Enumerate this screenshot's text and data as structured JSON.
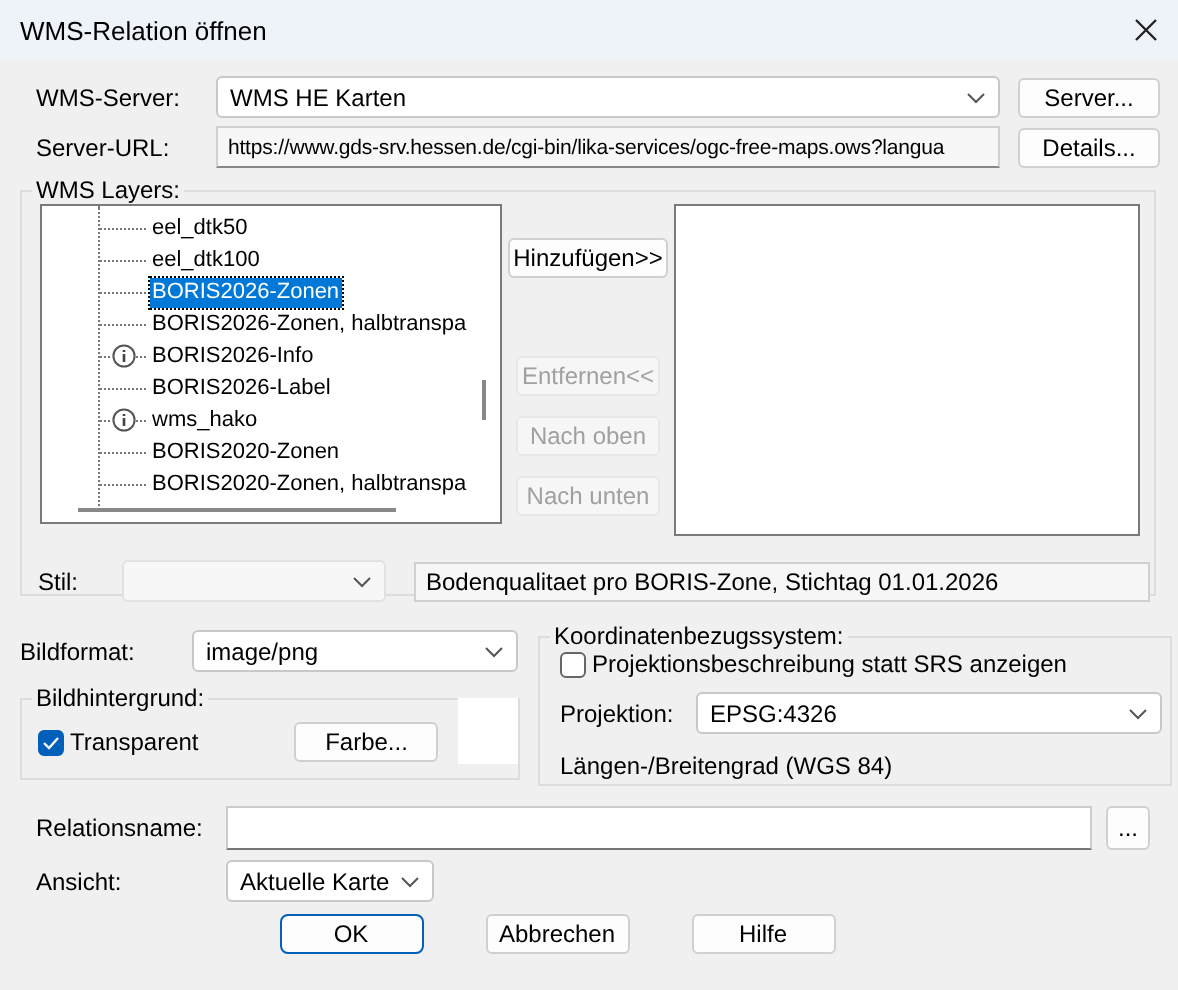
{
  "window": {
    "title": "WMS-Relation öffnen"
  },
  "server": {
    "label": "WMS-Server:",
    "value": "WMS HE Karten",
    "button": "Server..."
  },
  "url": {
    "label": "Server-URL:",
    "value": "https://www.gds-srv.hessen.de/cgi-bin/lika-services/ogc-free-maps.ows?langua",
    "button": "Details..."
  },
  "layers": {
    "title": "WMS Layers:",
    "tree": [
      {
        "label": "eel_dtk50",
        "kind": "layer",
        "selected": false
      },
      {
        "label": "eel_dtk100",
        "kind": "layer",
        "selected": false
      },
      {
        "label": "BORIS2026-Zonen",
        "kind": "layer",
        "selected": true
      },
      {
        "label": "BORIS2026-Zonen, halbtranspa",
        "kind": "layer",
        "selected": false
      },
      {
        "label": "BORIS2026-Info",
        "kind": "info",
        "selected": false
      },
      {
        "label": "BORIS2026-Label",
        "kind": "layer",
        "selected": false
      },
      {
        "label": "wms_hako",
        "kind": "info",
        "selected": false
      },
      {
        "label": "BORIS2020-Zonen",
        "kind": "layer",
        "selected": false
      },
      {
        "label": "BORIS2020-Zonen, halbtranspa",
        "kind": "layer",
        "selected": false
      }
    ],
    "buttons": [
      {
        "label": "Hinzufügen>>",
        "disabled": false
      },
      {
        "label": "Entfernen<<",
        "disabled": true
      },
      {
        "label": "Nach oben",
        "disabled": true
      },
      {
        "label": "Nach unten",
        "disabled": true
      }
    ],
    "style": {
      "label": "Stil:",
      "disabled": true
    },
    "description": "Bodenqualitaet pro BORIS-Zone, Stichtag 01.01.2026"
  },
  "image_format": {
    "label": "Bildformat:",
    "value": "image/png"
  },
  "background": {
    "title": "Bildhintergrund:",
    "transparent": {
      "label": "Transparent",
      "checked": true
    },
    "button": "Farbe..."
  },
  "crs": {
    "title": "Koordinatenbezugssystem:",
    "describe": {
      "label": "Projektionsbeschreibung statt SRS anzeigen",
      "checked": false
    },
    "projection_label": "Projektion:",
    "projection": "EPSG:4326",
    "info": "Längen-/Breitengrad (WGS 84)"
  },
  "relation_name": {
    "label": "Relationsname:",
    "button": "..."
  },
  "view": {
    "label": "Ansicht:",
    "value": "Aktuelle Karte"
  },
  "buttons": [
    {
      "label": "OK",
      "kind": "default"
    },
    {
      "label": "Abbrechen",
      "kind": "normal"
    },
    {
      "label": "Hilfe",
      "kind": "normal"
    }
  ]
}
